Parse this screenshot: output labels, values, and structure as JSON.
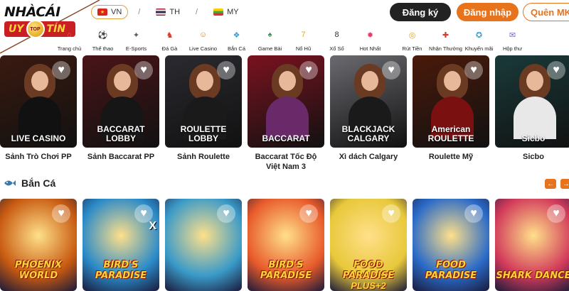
{
  "header": {
    "logo_top": "NHÀCÁI",
    "logo_left": "UY",
    "logo_coin": "TOP",
    "logo_right": "TÍN",
    "languages": [
      {
        "code": "VN",
        "flag_color": "#da251d",
        "active": true
      },
      {
        "code": "TH",
        "flag_color": "#2d2a4a",
        "active": false
      },
      {
        "code": "MY",
        "flag_color": "#fecb00",
        "active": false
      }
    ],
    "separator": "/",
    "register_label": "Đăng ký",
    "login_label": "Đăng nhập",
    "forgot_label": "Quên MK"
  },
  "nav": [
    {
      "label": "Trang chủ",
      "icon": "home-icon",
      "color": "#e8731d"
    },
    {
      "label": "Thể thao",
      "icon": "soccer-ball-icon",
      "color": "#3a8fd6"
    },
    {
      "label": "E-Sports",
      "icon": "gamepad-icon",
      "color": "#5c5c5c"
    },
    {
      "label": "Đá Gà",
      "icon": "rooster-icon",
      "color": "#d23a2a"
    },
    {
      "label": "Live Casino",
      "icon": "dealer-icon",
      "color": "#c77f3a"
    },
    {
      "label": "Bắn Cá",
      "icon": "fish-icon",
      "color": "#3aa0c9"
    },
    {
      "label": "Game Bài",
      "icon": "cards-icon",
      "color": "#2d9a5a"
    },
    {
      "label": "Nổ Hũ",
      "icon": "slot-machine-icon",
      "color": "#e8a31d"
    },
    {
      "label": "Xổ Số",
      "icon": "lottery-ball-icon",
      "color": "#333333"
    },
    {
      "label": "Hot Nhất",
      "icon": "fire-icon",
      "color": "#e83a6a"
    },
    {
      "label": "Rút Tiền",
      "icon": "coins-icon",
      "color": "#e8a31d"
    },
    {
      "label": "Nhận Thưởng",
      "icon": "gift-icon",
      "color": "#d23a2a"
    },
    {
      "label": "Khuyến mãi",
      "icon": "promo-icon",
      "color": "#3aa0c9"
    },
    {
      "label": "Hộp thư",
      "icon": "mail-icon",
      "color": "#6a6ad6"
    }
  ],
  "live_cards": [
    {
      "caption": "LIVE CASINO",
      "title": "Sảnh Trò Chơi PP",
      "bg": "#3a1a10",
      "body": "#111111"
    },
    {
      "caption": "BACCARAT LOBBY",
      "title": "Sảnh Baccarat PP",
      "bg": "#4a1418",
      "body": "#161616"
    },
    {
      "caption": "ROULETTE LOBBY",
      "title": "Sảnh Roulette",
      "bg": "#2a2a30",
      "body": "#1a1a1a"
    },
    {
      "caption": "BACCARAT",
      "title": "Baccarat Tốc Độ Việt Nam 3",
      "bg": "#7a1220",
      "body": "#6a2a6a"
    },
    {
      "caption": "BLACKJACK CALGARY",
      "title": "Xì dách Calgary",
      "bg": "#6a6a70",
      "body": "#1a1a1a"
    },
    {
      "caption": "American ROULETTE",
      "title": "Roulette Mỹ",
      "bg": "#4a1a0a",
      "body": "#7a1010"
    },
    {
      "caption": "Sicbo",
      "title": "Sicbo",
      "bg": "#1a3a3a",
      "body": "#e8e8e8"
    }
  ],
  "fish_section": {
    "title": "Bắn Cá",
    "prev_label": "←",
    "next_label": "→"
  },
  "fish_cards": [
    {
      "title": "PHOENIX WORLD",
      "sub": "",
      "tag": "",
      "bg": "#c85a10"
    },
    {
      "title": "BIRD'S PARADISE",
      "sub": "",
      "tag": "X",
      "bg": "#2a8ac8"
    },
    {
      "title": "",
      "sub": "",
      "tag": "",
      "bg": "#3a9ac8"
    },
    {
      "title": "BIRD'S PARADISE",
      "sub": "",
      "tag": "",
      "bg": "#e85a2a"
    },
    {
      "title": "FOOD PARADISE",
      "sub": "PLUS+2",
      "tag": "",
      "bg": "#e8c83a"
    },
    {
      "title": "FOOD PARADISE",
      "sub": "",
      "tag": "",
      "bg": "#2a6ac8"
    },
    {
      "title": "SHARK DANCE",
      "sub": "",
      "tag": "",
      "bg": "#d23a5a"
    }
  ]
}
